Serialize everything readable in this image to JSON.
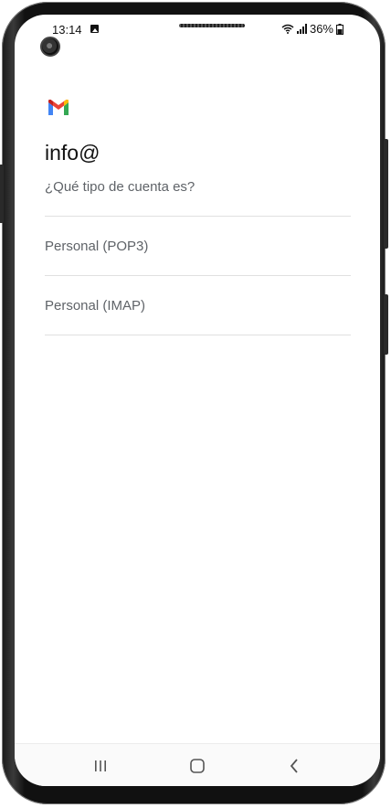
{
  "status_bar": {
    "time": "13:14",
    "battery": "36%",
    "icons": [
      "image-icon",
      "wifi-icon",
      "signal-icon",
      "battery-saver-icon"
    ]
  },
  "app": {
    "logo": "gmail-logo-icon",
    "colors": {
      "red": "#ea4335",
      "blue": "#4285f4",
      "green": "#34a853",
      "yellow": "#fbbc04"
    }
  },
  "main": {
    "account": "info@",
    "question": "¿Qué tipo de cuenta es?",
    "options": [
      {
        "label": "Personal (POP3)"
      },
      {
        "label": "Personal (IMAP)"
      }
    ]
  },
  "nav_bar": {
    "buttons": [
      "recents-icon",
      "home-icon",
      "back-icon"
    ]
  }
}
